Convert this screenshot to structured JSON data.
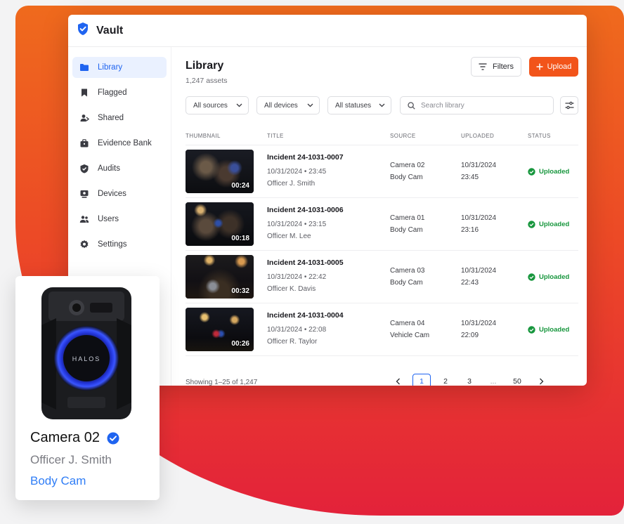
{
  "app": {
    "name": "Vault"
  },
  "sidebar": {
    "items": [
      {
        "label": "Library",
        "icon": "folder-icon",
        "active": true
      },
      {
        "label": "Flagged",
        "icon": "flag-icon",
        "active": false
      },
      {
        "label": "Shared",
        "icon": "share-user-icon",
        "active": false
      },
      {
        "label": "Evidence Bank",
        "icon": "briefcase-icon",
        "active": false
      },
      {
        "label": "Audits",
        "icon": "shield-icon",
        "active": false
      },
      {
        "label": "Devices",
        "icon": "device-icon",
        "active": false
      },
      {
        "label": "Users",
        "icon": "users-icon",
        "active": false
      },
      {
        "label": "Settings",
        "icon": "gear-icon",
        "active": false
      }
    ]
  },
  "page": {
    "title": "Library",
    "asset_count": "1,247 assets",
    "filters_label": "Filters",
    "upload_label": "Upload"
  },
  "filters": {
    "sources": "All sources",
    "devices": "All devices",
    "statuses": "All statuses",
    "search_placeholder": "Search library"
  },
  "table": {
    "headers": {
      "thumbnail": "THUMBNAIL",
      "title": "TITLE",
      "source": "SOURCE",
      "uploaded": "UPLOADED",
      "status": "STATUS"
    },
    "rows": [
      {
        "duration": "00:24",
        "title": "Incident 24-1031-0007",
        "datetime": "10/31/2024 • 23:45",
        "officer": "Officer J. Smith",
        "camera": "Camera 02",
        "cam_type": "Body Cam",
        "up_date": "10/31/2024",
        "up_time": "23:45",
        "status": "Uploaded"
      },
      {
        "duration": "00:18",
        "title": "Incident 24-1031-0006",
        "datetime": "10/31/2024 • 23:15",
        "officer": "Officer M. Lee",
        "camera": "Camera 01",
        "cam_type": "Body Cam",
        "up_date": "10/31/2024",
        "up_time": "23:16",
        "status": "Uploaded"
      },
      {
        "duration": "00:32",
        "title": "Incident 24-1031-0005",
        "datetime": "10/31/2024 • 22:42",
        "officer": "Officer K. Davis",
        "camera": "Camera 03",
        "cam_type": "Body Cam",
        "up_date": "10/31/2024",
        "up_time": "22:43",
        "status": "Uploaded"
      },
      {
        "duration": "00:26",
        "title": "Incident 24-1031-0004",
        "datetime": "10/31/2024 • 22:08",
        "officer": "Officer R. Taylor",
        "camera": "Camera 04",
        "cam_type": "Vehicle Cam",
        "up_date": "10/31/2024",
        "up_time": "22:09",
        "status": "Uploaded"
      }
    ]
  },
  "pagination": {
    "showing": "Showing 1–25 of 1,247",
    "pages": [
      "1",
      "2",
      "3",
      "...",
      "50"
    ],
    "current": "1"
  },
  "camera_card": {
    "name": "Camera 02",
    "officer": "Officer J. Smith",
    "type": "Body Cam",
    "device_brand": "HALOS"
  },
  "colors": {
    "accent": "#1f64f0",
    "upload": "#f2541a",
    "success": "#17963d",
    "background_gradient": [
      "#ef6a1d",
      "#e3223a"
    ]
  }
}
